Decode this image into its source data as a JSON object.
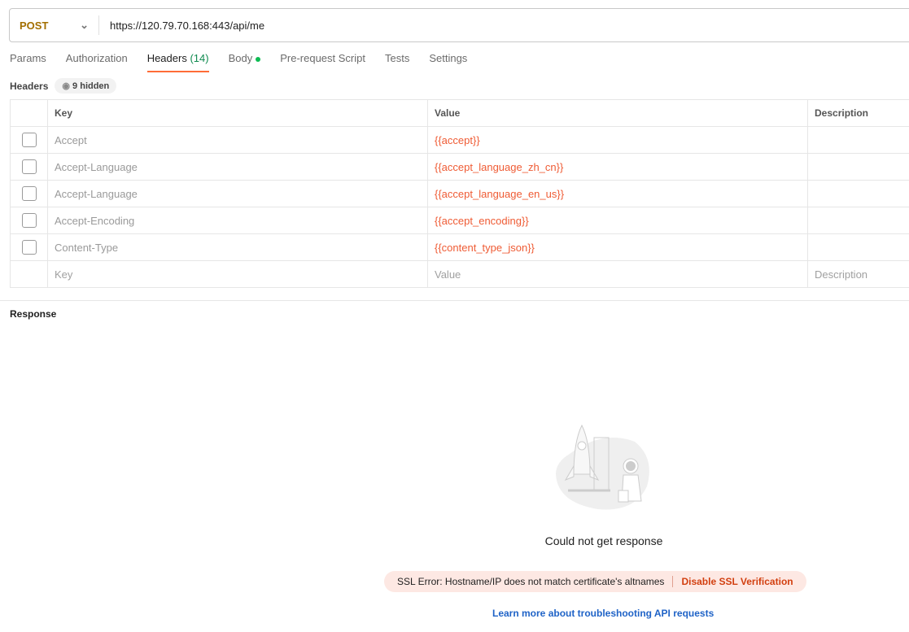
{
  "request": {
    "method": "POST",
    "url": "https://120.79.70.168:443/api/me"
  },
  "tabs": [
    {
      "label": "Params"
    },
    {
      "label": "Authorization"
    },
    {
      "label": "Headers",
      "count": "(14)"
    },
    {
      "label": "Body"
    },
    {
      "label": "Pre-request Script"
    },
    {
      "label": "Tests"
    },
    {
      "label": "Settings"
    }
  ],
  "headers": {
    "title": "Headers",
    "hidden": "9 hidden",
    "columns": [
      "Key",
      "Value",
      "Description"
    ],
    "rows": [
      {
        "key": "Accept",
        "value": "{{accept}}"
      },
      {
        "key": "Accept-Language",
        "value": "{{accept_language_zh_cn}}"
      },
      {
        "key": "Accept-Language",
        "value": "{{accept_language_en_us}}"
      },
      {
        "key": "Accept-Encoding",
        "value": "{{accept_encoding}}"
      },
      {
        "key": "Content-Type",
        "value": "{{content_type_json}}"
      }
    ],
    "placeholders": {
      "key": "Key",
      "value": "Value",
      "description": "Description"
    }
  },
  "response": {
    "title": "Response",
    "message": "Could not get response",
    "error": "SSL Error: Hostname/IP does not match certificate's altnames",
    "action": "Disable SSL Verification",
    "learn": "Learn more about troubleshooting API requests"
  }
}
